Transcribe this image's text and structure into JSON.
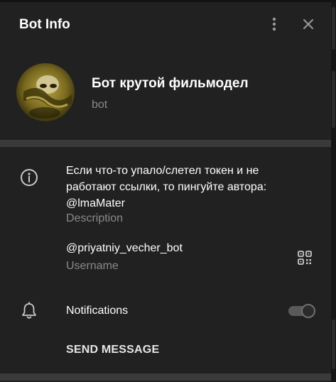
{
  "header": {
    "title": "Bot Info"
  },
  "profile": {
    "name": "Бот крутой фильмодел",
    "subtitle": "bot"
  },
  "info": {
    "description": "Если что-то упало/слетел токен и не работают ссылки, то пингуйте автора: @lmaMater",
    "description_label": "Description",
    "username": "@priyatniy_vecher_bot",
    "username_label": "Username"
  },
  "notifications": {
    "label": "Notifications",
    "enabled": false
  },
  "actions": {
    "send_message": "SEND MESSAGE"
  },
  "icons": [
    "more-vertical-icon",
    "close-icon",
    "info-icon",
    "qr-code-icon",
    "bell-icon"
  ],
  "colors": {
    "panel_background": "#212121",
    "section_divider": "#3a3a3a",
    "primary_text": "#ffffff",
    "secondary_text": "#8a8a8a"
  }
}
